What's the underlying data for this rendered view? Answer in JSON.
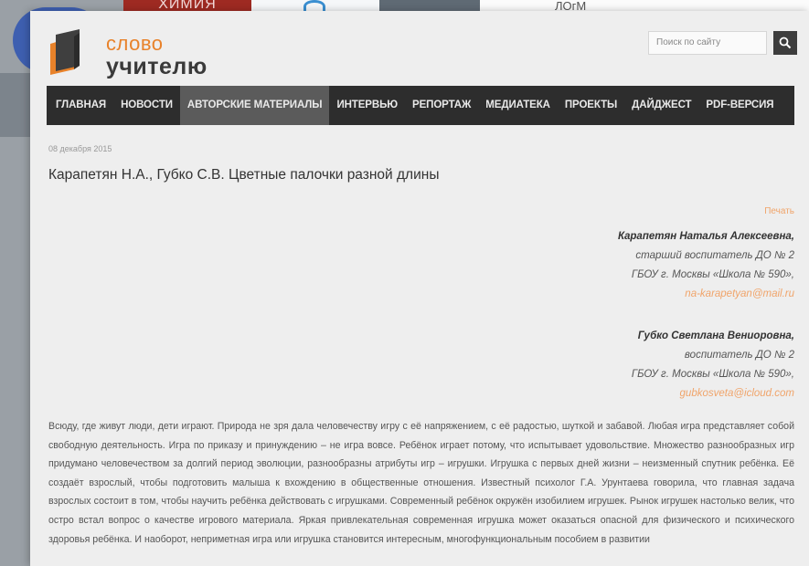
{
  "background": {
    "banner_text": "ХИМИЯ",
    "corner_text": "ЛОгМ"
  },
  "site": {
    "logo_line1": "слово",
    "logo_line2": "учителю",
    "search_placeholder": "Поиск по сайту"
  },
  "nav": {
    "items": [
      {
        "label": "ГЛАВНАЯ"
      },
      {
        "label": "НОВОСТИ"
      },
      {
        "label": "АВТОРСКИЕ МАТЕРИАЛЫ"
      },
      {
        "label": "ИНТЕРВЬЮ"
      },
      {
        "label": "РЕПОРТАЖ"
      },
      {
        "label": "МЕДИАТЕКА"
      },
      {
        "label": "ПРОЕКТЫ"
      },
      {
        "label": "ДАЙДЖЕСТ"
      },
      {
        "label": "PDF-ВЕРСИЯ"
      }
    ],
    "active_index": 2
  },
  "article": {
    "date": "08 декабря 2015",
    "title": "Карапетян Н.А., Губко С.В. Цветные палочки разной длины",
    "print_label": "Печать",
    "authors": [
      {
        "name": "Карапетян Наталья Алексеевна,",
        "position": "старший воспитатель ДО № 2",
        "school": "ГБОУ г. Москвы «Школа № 590»,",
        "email": "na-karapetyan@mail.ru"
      },
      {
        "name": "Губко Светлана Вениоровна,",
        "position": "воспитатель ДО № 2",
        "school": "ГБОУ г. Москвы «Школа № 590»,",
        "email": "gubkosveta@icloud.com"
      }
    ],
    "body": "Всюду, где живут люди, дети играют. Природа не зря дала человечеству игру с её напряжением, с её радостью, шуткой и забавой. Любая игра представляет собой свободную деятельность. Игра по приказу и принуждению – не игра вовсе. Ребёнок играет потому, что испытывает удовольствие. Множество разнообразных игр придумано человечеством за долгий период эволюции, разнообразны атрибуты игр – игрушки. Игрушка с первых дней жизни – неизменный спутник ребёнка. Её создаёт взрослый, чтобы подготовить малыша к вхождению в общественные отношения. Известный психолог Г.А. Урунтаева говорила, что главная задача взрослых состоит в том, чтобы научить ребёнка действовать с игрушками. Современный ребёнок окружён изобилием игрушек. Рынок игрушек настолько велик, что остро встал вопрос о качестве игрового материала. Яркая привлекательная современная игрушка может оказаться опасной для физического и психического здоровья ребёнка. И наоборот, неприметная игра или игрушка становится интересным, многофункциональным пособием в развитии"
  },
  "colors": {
    "accent": "#e8822a",
    "nav_bg": "#2d2d2d",
    "nav_active": "#5b5b5b",
    "link": "#f0a46a"
  }
}
